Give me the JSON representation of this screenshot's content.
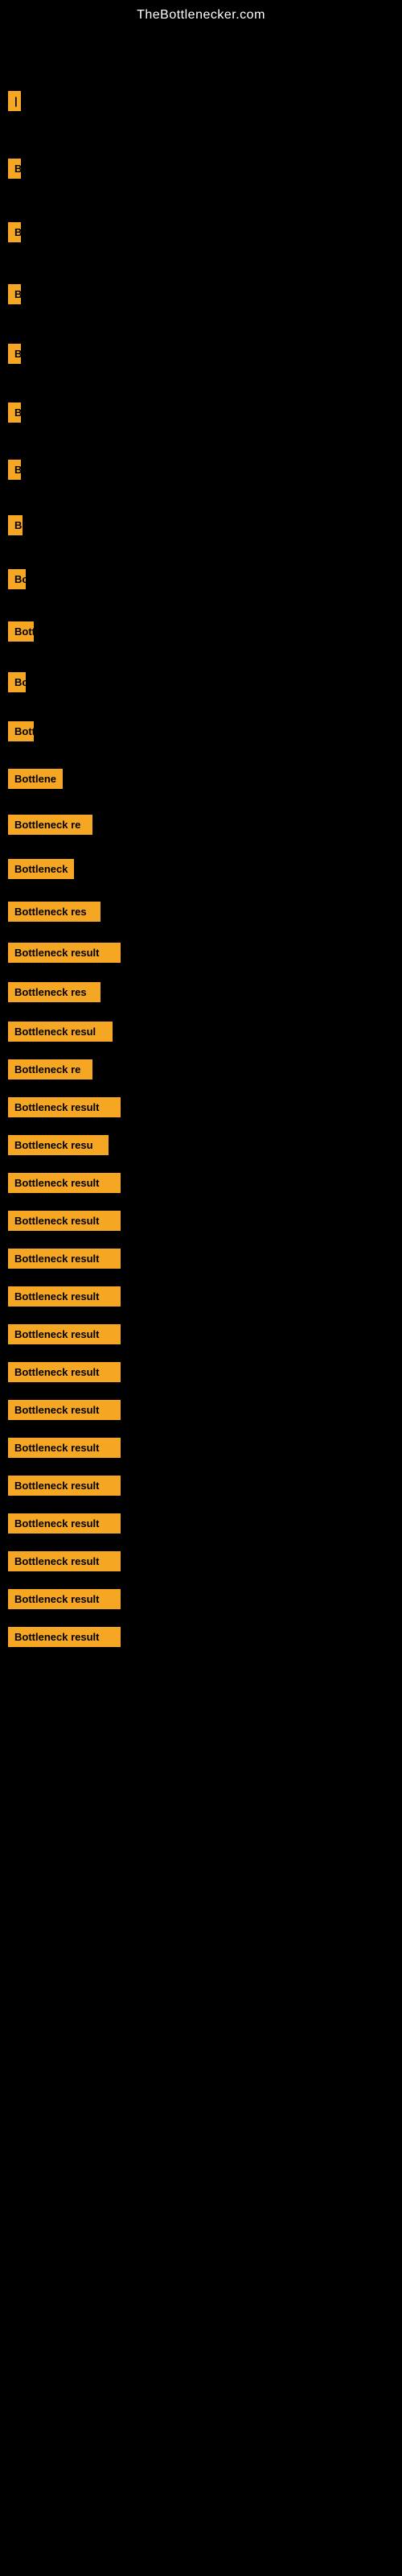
{
  "header": {
    "site_title": "TheBottlenecker.com"
  },
  "items": [
    {
      "id": 1,
      "label": "|",
      "width": 8,
      "spacer_before": 60
    },
    {
      "id": 2,
      "label": "B",
      "width": 12,
      "spacer_before": 55
    },
    {
      "id": 3,
      "label": "B",
      "width": 12,
      "spacer_before": 50
    },
    {
      "id": 4,
      "label": "B",
      "width": 14,
      "spacer_before": 48
    },
    {
      "id": 5,
      "label": "B",
      "width": 14,
      "spacer_before": 45
    },
    {
      "id": 6,
      "label": "B",
      "width": 14,
      "spacer_before": 44
    },
    {
      "id": 7,
      "label": "B",
      "width": 16,
      "spacer_before": 42
    },
    {
      "id": 8,
      "label": "B",
      "width": 18,
      "spacer_before": 40
    },
    {
      "id": 9,
      "label": "Bo",
      "width": 22,
      "spacer_before": 38
    },
    {
      "id": 10,
      "label": "Bott",
      "width": 32,
      "spacer_before": 36
    },
    {
      "id": 11,
      "label": "Bo",
      "width": 22,
      "spacer_before": 34
    },
    {
      "id": 12,
      "label": "Bott",
      "width": 32,
      "spacer_before": 32
    },
    {
      "id": 13,
      "label": "Bottlene",
      "width": 68,
      "spacer_before": 30
    },
    {
      "id": 14,
      "label": "Bottleneck re",
      "width": 105,
      "spacer_before": 28
    },
    {
      "id": 15,
      "label": "Bottleneck",
      "width": 82,
      "spacer_before": 26
    },
    {
      "id": 16,
      "label": "Bottleneck res",
      "width": 115,
      "spacer_before": 24
    },
    {
      "id": 17,
      "label": "Bottleneck result",
      "width": 140,
      "spacer_before": 22
    },
    {
      "id": 18,
      "label": "Bottleneck res",
      "width": 115,
      "spacer_before": 20
    },
    {
      "id": 19,
      "label": "Bottleneck resul",
      "width": 130,
      "spacer_before": 20
    },
    {
      "id": 20,
      "label": "Bottleneck re",
      "width": 105,
      "spacer_before": 18
    },
    {
      "id": 21,
      "label": "Bottleneck result",
      "width": 140,
      "spacer_before": 18
    },
    {
      "id": 22,
      "label": "Bottleneck resu",
      "width": 125,
      "spacer_before": 18
    },
    {
      "id": 23,
      "label": "Bottleneck result",
      "width": 140,
      "spacer_before": 18
    },
    {
      "id": 24,
      "label": "Bottleneck result",
      "width": 140,
      "spacer_before": 18
    },
    {
      "id": 25,
      "label": "Bottleneck result",
      "width": 140,
      "spacer_before": 18
    },
    {
      "id": 26,
      "label": "Bottleneck result",
      "width": 140,
      "spacer_before": 18
    },
    {
      "id": 27,
      "label": "Bottleneck result",
      "width": 140,
      "spacer_before": 18
    },
    {
      "id": 28,
      "label": "Bottleneck result",
      "width": 140,
      "spacer_before": 18
    },
    {
      "id": 29,
      "label": "Bottleneck result",
      "width": 140,
      "spacer_before": 18
    },
    {
      "id": 30,
      "label": "Bottleneck result",
      "width": 140,
      "spacer_before": 18
    },
    {
      "id": 31,
      "label": "Bottleneck result",
      "width": 140,
      "spacer_before": 18
    },
    {
      "id": 32,
      "label": "Bottleneck result",
      "width": 140,
      "spacer_before": 18
    },
    {
      "id": 33,
      "label": "Bottleneck result",
      "width": 140,
      "spacer_before": 18
    },
    {
      "id": 34,
      "label": "Bottleneck result",
      "width": 140,
      "spacer_before": 18
    },
    {
      "id": 35,
      "label": "Bottleneck result",
      "width": 140,
      "spacer_before": 18
    }
  ]
}
